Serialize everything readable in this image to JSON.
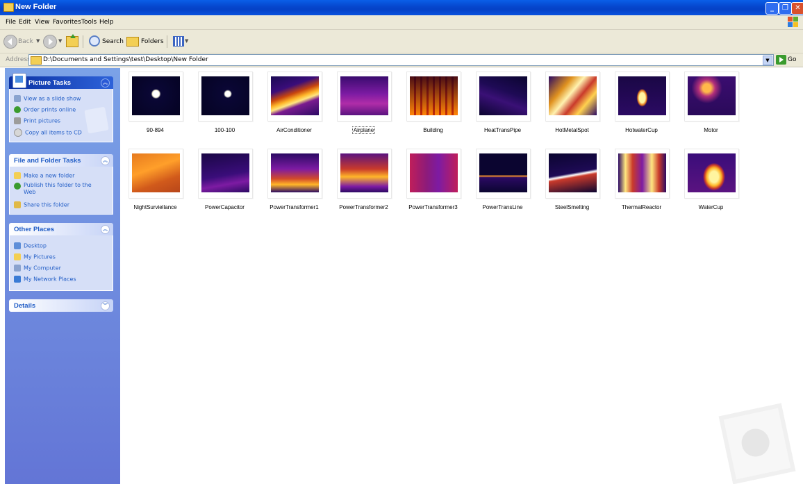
{
  "window": {
    "title": "New Folder"
  },
  "menu": [
    "File",
    "Edit",
    "View",
    "Favorites",
    "Tools",
    "Help"
  ],
  "toolbar": {
    "back": "Back",
    "search": "Search",
    "folders": "Folders"
  },
  "address": {
    "label": "Address",
    "path": "D:\\Documents and Settings\\test\\Desktop\\New Folder",
    "go": "Go"
  },
  "picture_tasks": {
    "title": "Picture Tasks",
    "items": [
      "View as a slide show",
      "Order prints online",
      "Print pictures",
      "Copy all items to CD"
    ]
  },
  "file_tasks": {
    "title": "File and Folder Tasks",
    "items": [
      "Make a new folder",
      "Publish this folder to the Web",
      "Share this folder"
    ]
  },
  "other_places": {
    "title": "Other Places",
    "items": [
      "Desktop",
      "My Pictures",
      "My Computer",
      "My Network Places"
    ]
  },
  "details": {
    "title": "Details"
  },
  "files": [
    {
      "name": "90-894",
      "style": "dot"
    },
    {
      "name": "100-100",
      "style": "dot-small"
    },
    {
      "name": "AirConditioner",
      "style": "ac"
    },
    {
      "name": "Airplane",
      "style": "plane",
      "selected": true
    },
    {
      "name": "Building",
      "style": "building"
    },
    {
      "name": "HeatTransPipe",
      "style": "pipe"
    },
    {
      "name": "HotMetalSpot",
      "style": "hotmetal"
    },
    {
      "name": "HotwaterCup",
      "style": "cup"
    },
    {
      "name": "Motor",
      "style": "motor"
    },
    {
      "name": "NightSurviellance",
      "style": "night"
    },
    {
      "name": "PowerCapacitor",
      "style": "capacitor"
    },
    {
      "name": "PowerTransformer1",
      "style": "pt1"
    },
    {
      "name": "PowerTransformer2",
      "style": "pt2"
    },
    {
      "name": "PowerTransformer3",
      "style": "pt3"
    },
    {
      "name": "PowerTransLine",
      "style": "line"
    },
    {
      "name": "SteelSmelting",
      "style": "steel"
    },
    {
      "name": "ThermalReactor",
      "style": "reactor"
    },
    {
      "name": "WaterCup",
      "style": "watercup"
    }
  ]
}
